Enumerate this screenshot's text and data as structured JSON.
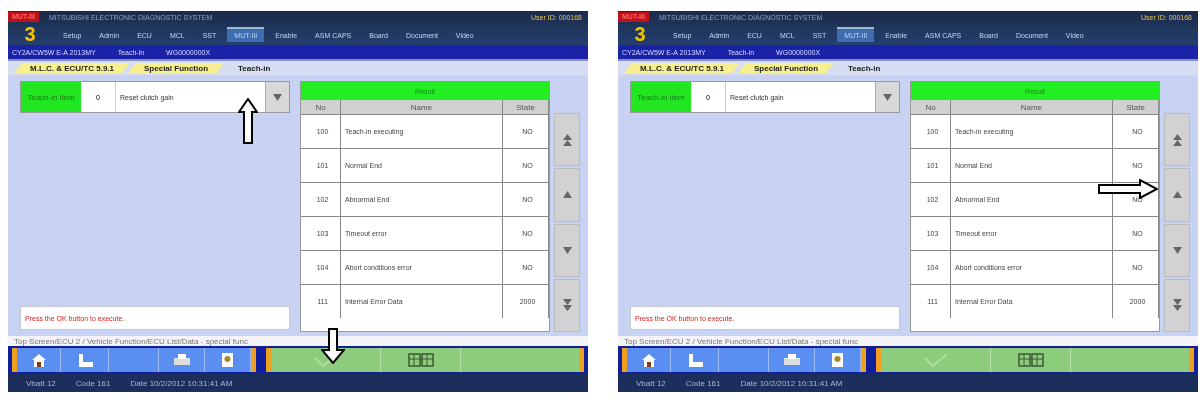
{
  "panels": [
    {
      "header": {
        "brand": "MUT-III",
        "logo": "3",
        "title": "MITSUBISHI ELECTRONIC DIAGNOSTIC SYSTEM",
        "user": "User ID: 000168",
        "nav": [
          {
            "label": "Setup",
            "selected": false
          },
          {
            "label": "Admin",
            "selected": false
          },
          {
            "label": "ECU",
            "selected": false
          },
          {
            "label": "MCL",
            "selected": false
          },
          {
            "label": "SST",
            "selected": false
          },
          {
            "label": "MUT-III",
            "selected": true
          },
          {
            "label": "Enable",
            "selected": false
          },
          {
            "label": "ASM CAPS",
            "selected": false
          },
          {
            "label": "Board",
            "selected": false
          },
          {
            "label": "Document",
            "selected": false
          },
          {
            "label": "Video",
            "selected": false
          }
        ]
      },
      "info": [
        "CY2A/CW5W E-A 2013MY",
        "Teach-in",
        "WG0000000X"
      ],
      "breadcrumbs": [
        {
          "label": "M.L.C. & ECU/TC 5.9.1",
          "selected": false
        },
        {
          "label": "Special Function",
          "selected": false
        },
        {
          "label": "Teach-in",
          "selected": true
        }
      ],
      "selector": {
        "label": "Teach-in item",
        "number": "0",
        "value": "Reset clutch gain"
      },
      "table": {
        "title": "Result",
        "columns": [
          "No",
          "Name",
          "State"
        ],
        "rows": [
          [
            "100",
            "Teach-in executing",
            "NO"
          ],
          [
            "101",
            "Normal End",
            "NO"
          ],
          [
            "102",
            "Abnormal End",
            "NO"
          ],
          [
            "103",
            "Timeout error",
            "NO"
          ],
          [
            "104",
            "Abort conditions error",
            "NO"
          ],
          [
            "111",
            "Internal Error Data",
            "2000"
          ]
        ]
      },
      "message": "Press the OK button to execute.",
      "path": "Top Screen/ECU 2 / Vehicle Function/ECU List/Data - special func",
      "status": [
        "Vbatt 12",
        "Code 161",
        "Date 10/2/2012 10:31:41 AM"
      ],
      "arrows": [
        {
          "kind": "up"
        },
        {
          "kind": "down"
        }
      ]
    },
    {
      "header": {
        "brand": "MUT-III",
        "logo": "3",
        "title": "MITSUBISHI ELECTRONIC DIAGNOSTIC SYSTEM",
        "user": "User ID: 000168",
        "nav": [
          {
            "label": "Setup",
            "selected": false
          },
          {
            "label": "Admin",
            "selected": false
          },
          {
            "label": "ECU",
            "selected": false
          },
          {
            "label": "MCL",
            "selected": false
          },
          {
            "label": "SST",
            "selected": false
          },
          {
            "label": "MUT-III",
            "selected": true
          },
          {
            "label": "Enable",
            "selected": false
          },
          {
            "label": "ASM CAPS",
            "selected": false
          },
          {
            "label": "Board",
            "selected": false
          },
          {
            "label": "Document",
            "selected": false
          },
          {
            "label": "Video",
            "selected": false
          }
        ]
      },
      "info": [
        "CY2A/CW5W E-A 2013MY",
        "Teach-in",
        "WG0000000X"
      ],
      "breadcrumbs": [
        {
          "label": "M.L.C. & ECU/TC 5.9.1",
          "selected": false
        },
        {
          "label": "Special Function",
          "selected": false
        },
        {
          "label": "Teach-in",
          "selected": true
        }
      ],
      "selector": {
        "label": "Teach-in item",
        "number": "0",
        "value": "Reset clutch gain"
      },
      "table": {
        "title": "Result",
        "columns": [
          "No",
          "Name",
          "State"
        ],
        "rows": [
          [
            "100",
            "Teach-in executing",
            "NO"
          ],
          [
            "101",
            "Normal End",
            "NO"
          ],
          [
            "102",
            "Abnormal End",
            "NO"
          ],
          [
            "103",
            "Timeout error",
            "NO"
          ],
          [
            "104",
            "Abort conditions error",
            "NO"
          ],
          [
            "111",
            "Internal Error Data",
            "2000"
          ]
        ]
      },
      "message": "Press the OK button to execute.",
      "path": "Top Screen/ECU 2 / Vehicle Function/ECU List/Data - special func",
      "status": [
        "Vbatt 12",
        "Code 161",
        "Date 10/2/2012 10:31:41 AM"
      ],
      "arrows": [
        {
          "kind": "right"
        }
      ]
    }
  ]
}
